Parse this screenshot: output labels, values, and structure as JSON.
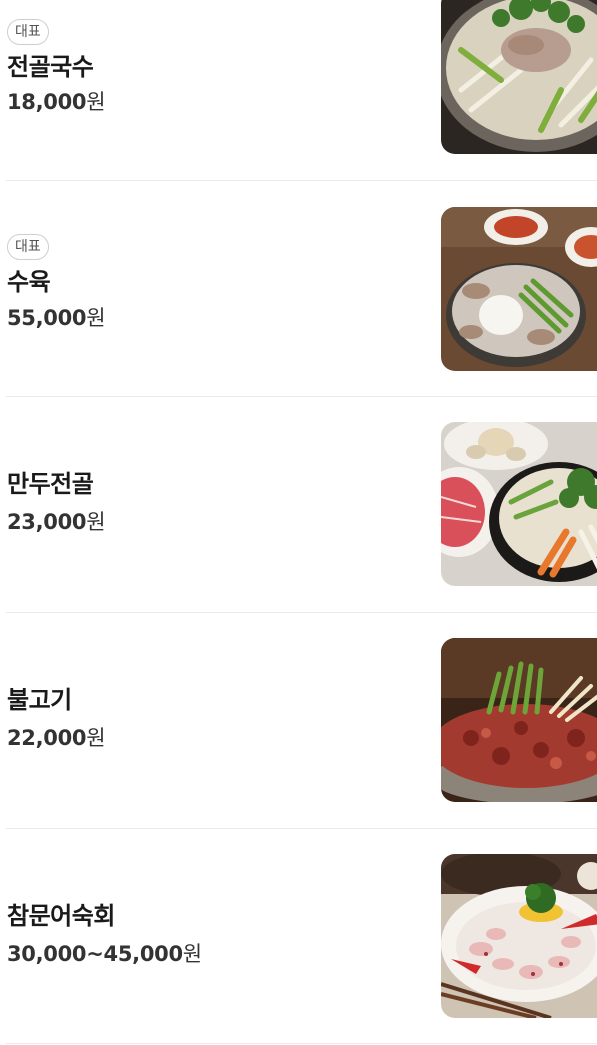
{
  "menu": {
    "items": [
      {
        "badge": "대표",
        "name": "전골국수",
        "price": "18,000",
        "currency": "원",
        "image_icon": "hotpot-noodle-photo"
      },
      {
        "badge": "대표",
        "name": "수육",
        "price": "55,000",
        "currency": "원",
        "image_icon": "boiled-pork-photo"
      },
      {
        "badge": "",
        "name": "만두전골",
        "price": "23,000",
        "currency": "원",
        "image_icon": "dumpling-hotpot-photo"
      },
      {
        "badge": "",
        "name": "불고기",
        "price": "22,000",
        "currency": "원",
        "image_icon": "bulgogi-photo"
      },
      {
        "badge": "",
        "name": "참문어숙회",
        "price": "30,000~45,000",
        "currency": "원",
        "image_icon": "octopus-photo"
      }
    ]
  }
}
